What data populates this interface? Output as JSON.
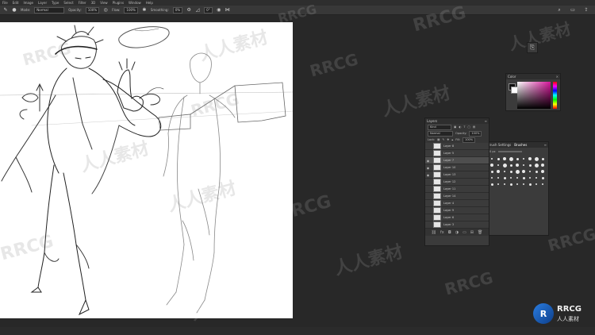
{
  "menu": {
    "items": [
      "File",
      "Edit",
      "Image",
      "Layer",
      "Type",
      "Select",
      "Filter",
      "3D",
      "View",
      "Plugins",
      "Window",
      "Help"
    ]
  },
  "options": {
    "mode_label": "Mode:",
    "mode_value": "Normal",
    "opacity_label": "Opacity:",
    "opacity_value": "100%",
    "flow_label": "Flow:",
    "flow_value": "100%",
    "smoothing_label": "Smoothing:",
    "smoothing_value": "0%",
    "angle_value": "0°"
  },
  "color_panel": {
    "title": "Color",
    "accent": "#d8169b"
  },
  "layers_panel": {
    "title": "Layers",
    "search_placeholder": "Kind",
    "blend_mode": "Normal",
    "opacity_label": "Opacity:",
    "opacity_value": "100%",
    "lock_label": "Lock:",
    "fill_label": "Fill:",
    "fill_value": "100%",
    "layers": [
      {
        "name": "Layer 8",
        "visible": false,
        "selected": false
      },
      {
        "name": "Layer 5",
        "visible": false,
        "selected": false
      },
      {
        "name": "Layer 7",
        "visible": true,
        "selected": true
      },
      {
        "name": "Layer 10",
        "visible": true,
        "selected": false
      },
      {
        "name": "Layer 13",
        "visible": true,
        "selected": false
      },
      {
        "name": "Layer 12",
        "visible": false,
        "selected": false
      },
      {
        "name": "Layer 11",
        "visible": false,
        "selected": false
      },
      {
        "name": "Layer 14",
        "visible": false,
        "selected": false
      },
      {
        "name": "Layer 4",
        "visible": false,
        "selected": false
      },
      {
        "name": "Layer 9",
        "visible": false,
        "selected": false
      },
      {
        "name": "Layer 6",
        "visible": false,
        "selected": false
      },
      {
        "name": "Layer 3",
        "visible": false,
        "selected": false
      }
    ]
  },
  "brushes_panel": {
    "tabs": [
      "Brush Settings",
      "Brushes"
    ],
    "size_value": "0 px"
  },
  "watermarks": [
    "RRCG",
    "人人素材"
  ],
  "logo": {
    "name": "RRCG",
    "sub": "人人素材"
  }
}
